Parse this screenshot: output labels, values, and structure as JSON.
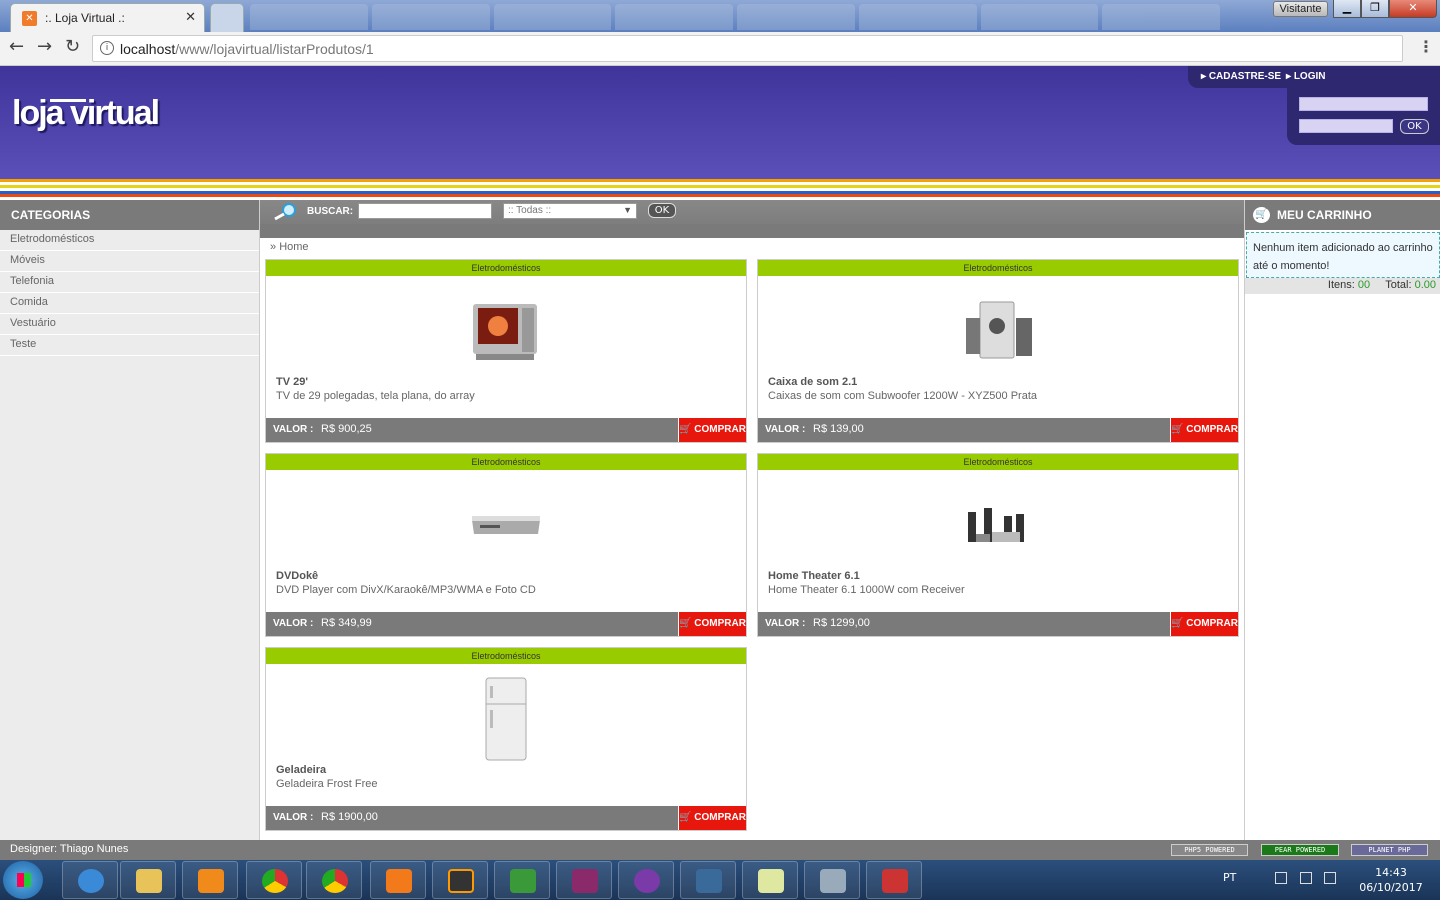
{
  "browser": {
    "tab_title": ":. Loja Virtual .:",
    "tab_icon": "xampp-icon",
    "url_host": "localhost",
    "url_path": "/www/lojavirtual/listarProdutos/1",
    "user": "Visitante"
  },
  "header": {
    "logo": "loja virtual",
    "signup": "CADASTRE-SE",
    "login": "LOGIN",
    "login_ok": "OK"
  },
  "sidebar": {
    "title": "CATEGORIAS",
    "items": [
      "Eletrodomésticos",
      "Móveis",
      "Telefonia",
      "Comida",
      "Vestuário",
      "Teste"
    ]
  },
  "search": {
    "label": "BUSCAR:",
    "select_value": ":: Todas ::",
    "ok": "OK"
  },
  "breadcrumb": {
    "prefix": "»",
    "home": "Home"
  },
  "products": [
    {
      "category": "Eletrodomésticos",
      "name": "TV 29'",
      "description": "TV de 29 polegadas, tela plana, do array",
      "price_label": "VALOR :",
      "price": "R$ 900,25",
      "buy": "COMPRAR",
      "image": "tv-image"
    },
    {
      "category": "Eletrodomésticos",
      "name": "Caixa de som 2.1",
      "description": "Caixas de som com Subwoofer 1200W - XYZ500 Prata",
      "price_label": "VALOR :",
      "price": "R$ 139,00",
      "buy": "COMPRAR",
      "image": "speakers-image"
    },
    {
      "category": "Eletrodomésticos",
      "name": "DVDokê",
      "description": "DVD Player com DivX/Karaokê/MP3/WMA e Foto CD",
      "price_label": "VALOR :",
      "price": "R$ 349,99",
      "buy": "COMPRAR",
      "image": "dvd-player-image"
    },
    {
      "category": "Eletrodomésticos",
      "name": "Home Theater 6.1",
      "description": "Home Theater 6.1 1000W com Receiver",
      "price_label": "VALOR :",
      "price": "R$ 1299,00",
      "buy": "COMPRAR",
      "image": "home-theater-image"
    },
    {
      "category": "Eletrodomésticos",
      "name": "Geladeira",
      "description": "Geladeira Frost Free",
      "price_label": "VALOR :",
      "price": "R$ 1900,00",
      "buy": "COMPRAR",
      "image": "fridge-image"
    }
  ],
  "cart": {
    "title": "MEU CARRINHO",
    "empty": "Nenhum item adicionado ao carrinho até o momento!",
    "items_label": "Itens:",
    "items_value": "00",
    "total_label": "Total:",
    "total_value": "0.00"
  },
  "footer": {
    "designer": "Designer: Thiago Nunes",
    "badges": [
      "PHP5 POWERED",
      "PEAR POWERED",
      "PLANET PHP"
    ]
  },
  "taskbar": {
    "lang": "PT",
    "time": "14:43",
    "date": "06/10/2017"
  },
  "colors": {
    "header": "#4b41ac",
    "category_bar": "#99cc00",
    "buy_button": "#e8170d",
    "panel_gray": "#7a7a7a"
  }
}
